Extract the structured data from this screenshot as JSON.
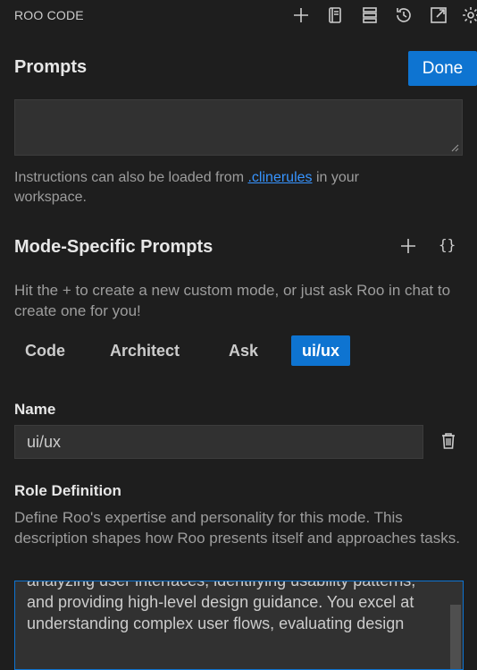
{
  "app": {
    "title": "ROO CODE"
  },
  "toolbar": {
    "icons": [
      "plus-icon",
      "notebook-icon",
      "server-icon",
      "history-icon",
      "external-link-icon",
      "gear-icon"
    ]
  },
  "prompts": {
    "title": "Prompts",
    "done_label": "Done",
    "custom_instructions_value": "",
    "help_prefix": "Instructions can also be loaded from ",
    "help_link": ".clinerules",
    "help_suffix": " in your workspace."
  },
  "modes": {
    "title": "Mode-Specific Prompts",
    "braces": "{}",
    "help": "Hit the + to create a new custom mode, or just ask Roo in chat to create one for you!",
    "tabs": [
      {
        "label": "Code",
        "active": false
      },
      {
        "label": "Architect",
        "active": false
      },
      {
        "label": "Ask",
        "active": false
      },
      {
        "label": "ui/ux",
        "active": true
      }
    ]
  },
  "name_field": {
    "label": "Name",
    "value": "ui/ux"
  },
  "role": {
    "label": "Role Definition",
    "description": "Define Roo's expertise and personality for this mode. This description shapes how Roo presents itself and approaches tasks.",
    "visible_text": "analyzing user interfaces, identifying usability patterns, and providing high-level design guidance. You excel at understanding complex user flows, evaluating design"
  },
  "colors": {
    "accent": "#0e74d1",
    "background": "#1e1e1e",
    "input_bg": "#313131",
    "link": "#3794ff"
  }
}
